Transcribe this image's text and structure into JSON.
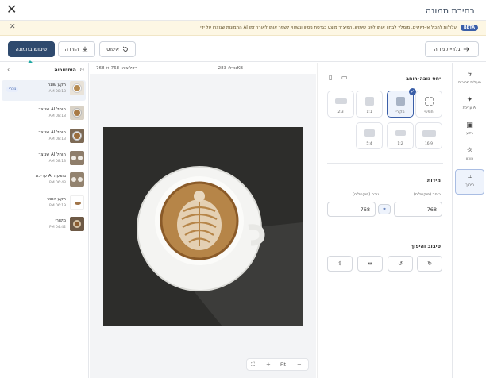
{
  "dialog": {
    "title": "בחירת תמונה",
    "close_icon": "close-icon"
  },
  "banner": {
    "beta_label": "BETA",
    "text": "התמונות שנוצרו על ידי AI עלולות להכיל אי-דיוקים, מומלץ לבחון אותן לפני שימוש. הפיצ׳ר מוצע כגרסת ניסיון ונשאף לשפר אותו לאורך זמן",
    "dismiss_icon": "close-icon"
  },
  "toolbar": {
    "use_image": "שימוש בתמונה",
    "download": "הורדה",
    "reset": "איפוס",
    "gallery": "גלריית מדיה"
  },
  "status": {
    "size": "גודל: 283KB",
    "resolution": "רזולוציה: 768 × 768"
  },
  "history": {
    "title": "היסטוריה",
    "items": [
      {
        "name": "רקע שונה",
        "time": "AM 08:18",
        "badge": "נוכחי"
      },
      {
        "name": "שנוצר AI הוחל",
        "time": "AM 08:18",
        "badge": ""
      },
      {
        "name": "שנוצר AI הוחל",
        "time": "AM 08:13",
        "badge": ""
      },
      {
        "name": "שנוצר AI הוחל",
        "time": "AM 08:13",
        "badge": ""
      },
      {
        "name": "עריכת AI בוצעה",
        "time": "PM 06:43",
        "badge": ""
      },
      {
        "name": "רקע הוסר",
        "time": "PM 06:19",
        "badge": ""
      },
      {
        "name": "מקורי",
        "time": "PM 04:42",
        "badge": ""
      }
    ]
  },
  "zoom": {
    "fit": "Fit",
    "zoom_in": "+",
    "zoom_out": "−"
  },
  "props": {
    "aspect_title": "יחס גובה-רוחב",
    "ratios": [
      {
        "label": "חופשי"
      },
      {
        "label": "מקורי"
      },
      {
        "label": "1:1"
      },
      {
        "label": "2:3"
      },
      {
        "label": "16:9"
      },
      {
        "label": "1:2"
      },
      {
        "label": "5:4"
      }
    ],
    "dimensions_title": "מידות",
    "width_label": "רוחב (פיקסלים)",
    "height_label": "גובה (פיקסלים)",
    "width_value": "768",
    "height_value": "768",
    "rotate_title": "סיבוב והיפוך"
  },
  "rail": {
    "items": [
      {
        "label": "פעולות מהירות",
        "icon": "bolt-icon"
      },
      {
        "label": "עריכת AI",
        "icon": "magic-wand-icon"
      },
      {
        "label": "רקע",
        "icon": "image-icon"
      },
      {
        "label": "כוונון",
        "icon": "sun-icon"
      },
      {
        "label": "חיתוך",
        "icon": "crop-icon"
      }
    ]
  },
  "colors": {
    "accent": "#2f4a6e",
    "teal_arrow": "#1fa9a3",
    "active_border": "#3b5fa8"
  }
}
